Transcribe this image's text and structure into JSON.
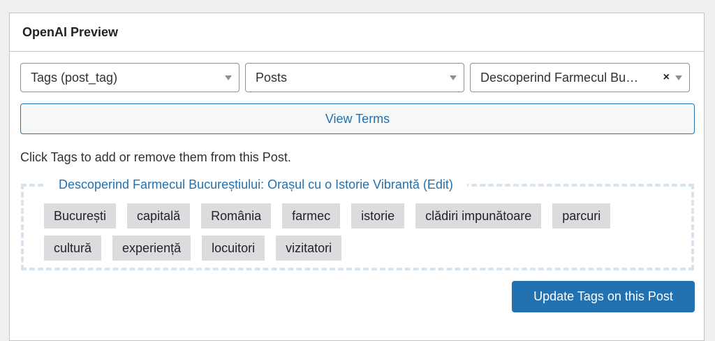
{
  "panel": {
    "title": "OpenAI Preview"
  },
  "filters": {
    "taxonomy": "Tags (post_tag)",
    "post_type": "Posts",
    "post": "Descoperind Farmecul Bu…",
    "clear_symbol": "×"
  },
  "view_terms_label": "View Terms",
  "instructions": "Click Tags to add or remove them from this Post.",
  "post_title_link": "Descoperind Farmecul Bucureștiului: Orașul cu o Istorie Vibrantă (Edit)",
  "tags": {
    "row1": [
      "București",
      "capitală",
      "România",
      "farmec",
      "istorie",
      "clădiri impunătoare",
      "parcuri"
    ],
    "row2": [
      "cultură",
      "experiență",
      "locuitori",
      "vizitatori"
    ]
  },
  "update_button_label": "Update Tags on this Post"
}
